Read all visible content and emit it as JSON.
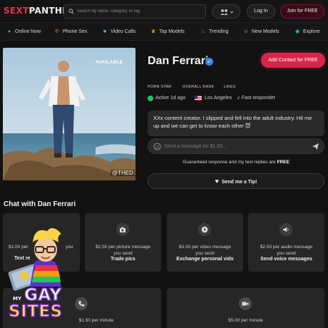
{
  "header": {
    "logo_part1": "SEXT",
    "logo_part2": "PANTHER",
    "search_placeholder": "Search by name, category, or tag",
    "login_label": "Log In",
    "join_label": "Join for FREE"
  },
  "nav": {
    "items": [
      {
        "label": "Online Now",
        "icon": "green-dot-icon"
      },
      {
        "label": "Phone Sex",
        "icon": "phone-icon"
      },
      {
        "label": "Video Calls",
        "icon": "video-icon"
      },
      {
        "label": "Top Models",
        "icon": "trophy-icon"
      },
      {
        "label": "Trending",
        "icon": "fire-icon"
      },
      {
        "label": "New Models",
        "icon": "smile-icon"
      },
      {
        "label": "Explore",
        "icon": "globe-icon"
      }
    ]
  },
  "profile": {
    "available_label": "AVAILABLE",
    "watermark": "@THED",
    "name": "Dan Ferrari",
    "contact_label": "Add Contact for FREE",
    "stats": [
      "PORN STAR",
      "OVERALL RANK",
      "LIKES"
    ],
    "active": "Active 1d ago",
    "location": "Los Angeles",
    "responder": "Fast responder",
    "bio": "XXx content creator. I slipped and fell into the adult industry. Hit me up and we can get to know each other 😈",
    "message_placeholder": "Send a message for $1.00...",
    "guarantee_text": "Guaranteed response and my text replies are",
    "guarantee_bold": "FREE",
    "tip_label": "Send me a Tip!"
  },
  "chat": {
    "title": "Chat with Dan Ferrari",
    "cards": [
      {
        "price": "$1.00 per",
        "price_right": "you",
        "title": "Text re"
      },
      {
        "price": "$2.50 per picture message you send",
        "title": "Trade pics"
      },
      {
        "price": "$3.00 per video message you send",
        "title": "Exchange personal vids"
      },
      {
        "price": "$2.50 per audio message you send",
        "title": "Send voice messages"
      }
    ],
    "cards_row2": [
      {
        "price": "$1.50 per minute"
      },
      {
        "price": "$5.00 per minute"
      }
    ]
  },
  "badge": {
    "my": "MY",
    "gay": "GAY",
    "sites": "SITES"
  },
  "colors": {
    "accent": "#d8264b",
    "background": "#121212",
    "card": "#262626",
    "online": "#22c55e"
  }
}
